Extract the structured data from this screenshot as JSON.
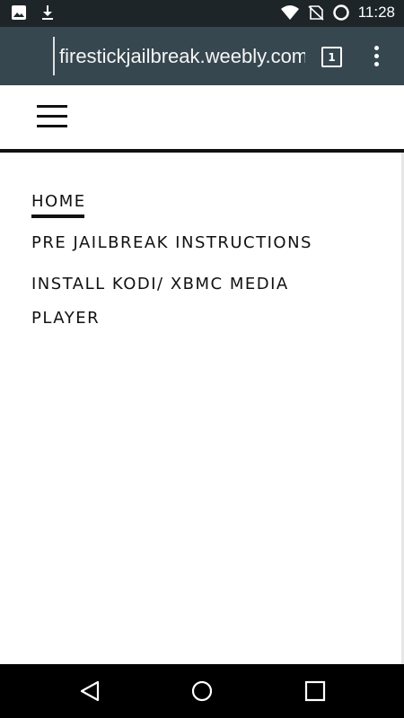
{
  "status_bar": {
    "time": "11:28",
    "left_icons": [
      "image-icon",
      "download-icon"
    ],
    "right_icons": [
      "wifi-icon",
      "no-sim-icon",
      "loading-icon"
    ]
  },
  "browser": {
    "url": "firestickjailbreak.weebly.com",
    "tab_count": "1",
    "menu_icon": "more-vert-icon"
  },
  "site": {
    "menu_icon": "hamburger-icon",
    "nav": {
      "home": "HOME",
      "pre_jailbreak": "PRE JAILBREAK INSTRUCTIONS",
      "install_kodi": "INSTALL KODI/ XBMC MEDIA PLAYER"
    }
  },
  "system_nav": {
    "icons": [
      "back-icon",
      "home-icon",
      "recents-icon"
    ]
  },
  "colors": {
    "status_bar": "#1e2529",
    "toolbar": "#37474f",
    "text": "#111111"
  }
}
